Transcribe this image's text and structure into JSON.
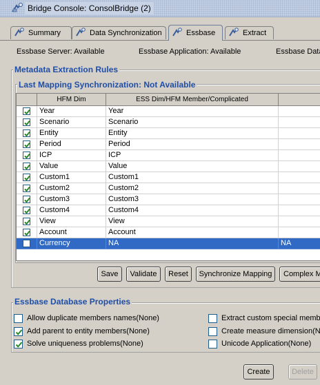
{
  "window": {
    "title": "Bridge Console: ConsolBridge (2)"
  },
  "tabs": [
    {
      "label": "Summary",
      "active": false
    },
    {
      "label": "Data Synchronization",
      "active": false
    },
    {
      "label": "Essbase",
      "active": true
    },
    {
      "label": "Extract",
      "active": false
    }
  ],
  "status": {
    "server": "Essbase Server: Available",
    "application": "Essbase Application: Available",
    "database": "Essbase Data"
  },
  "metadata": {
    "title": "Metadata Extraction Rules",
    "mapping_title": "Last Mapping Synchronization: Not Available",
    "columns": [
      "HFM Dim",
      "ESS Dim/HFM Member/Complicated",
      ""
    ],
    "rows": [
      {
        "checked": true,
        "hfm": "Year",
        "ess": "Year",
        "extra": "",
        "selected": false
      },
      {
        "checked": true,
        "hfm": "Scenario",
        "ess": "Scenario",
        "extra": "",
        "selected": false
      },
      {
        "checked": true,
        "hfm": "Entity",
        "ess": "Entity",
        "extra": "",
        "selected": false
      },
      {
        "checked": true,
        "hfm": "Period",
        "ess": "Period",
        "extra": "",
        "selected": false
      },
      {
        "checked": true,
        "hfm": "ICP",
        "ess": "ICP",
        "extra": "",
        "selected": false
      },
      {
        "checked": true,
        "hfm": "Value",
        "ess": "Value",
        "extra": "",
        "selected": false
      },
      {
        "checked": true,
        "hfm": "Custom1",
        "ess": "Custom1",
        "extra": "",
        "selected": false
      },
      {
        "checked": true,
        "hfm": "Custom2",
        "ess": "Custom2",
        "extra": "",
        "selected": false
      },
      {
        "checked": true,
        "hfm": "Custom3",
        "ess": "Custom3",
        "extra": "",
        "selected": false
      },
      {
        "checked": true,
        "hfm": "Custom4",
        "ess": "Custom4",
        "extra": "",
        "selected": false
      },
      {
        "checked": true,
        "hfm": "View",
        "ess": "View",
        "extra": "",
        "selected": false
      },
      {
        "checked": true,
        "hfm": "Account",
        "ess": "Account",
        "extra": "",
        "selected": false
      },
      {
        "checked": false,
        "hfm": "Currency",
        "ess": "NA",
        "extra": "NA",
        "selected": true
      }
    ],
    "buttons": {
      "save": "Save",
      "validate": "Validate",
      "reset": "Reset",
      "synchronize": "Synchronize Mapping",
      "complex": "Complex Ma"
    }
  },
  "db_props": {
    "title": "Essbase Database Properties",
    "options": [
      {
        "label": "Allow duplicate members names(None)",
        "checked": false
      },
      {
        "label": "Extract custom special membe",
        "checked": false
      },
      {
        "label": "Add parent to entity members(None)",
        "checked": true
      },
      {
        "label": "Create measure dimension(None",
        "checked": false
      },
      {
        "label": "Solve uniqueness problems(None)",
        "checked": true
      },
      {
        "label": "Unicode Application(None)",
        "checked": false
      }
    ]
  },
  "footer": {
    "create": "Create",
    "delete": "Delete"
  },
  "colors": {
    "accent": "#1f4ea7",
    "selection": "#316ac5",
    "check": "#2a8a2a"
  }
}
